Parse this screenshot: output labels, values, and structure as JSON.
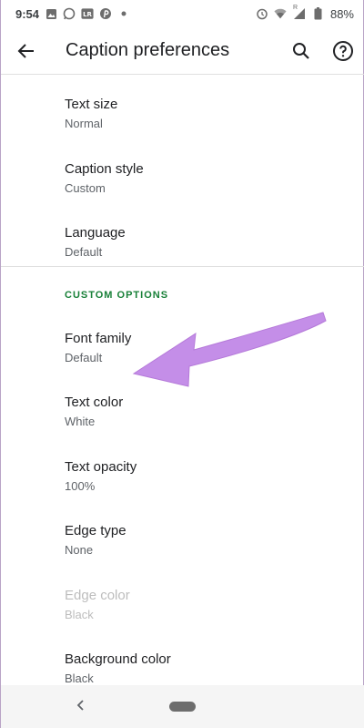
{
  "status_bar": {
    "time": "9:54",
    "battery": "88%",
    "signal_label": "R"
  },
  "app_bar": {
    "title": "Caption preferences"
  },
  "list": {
    "items_top": [
      {
        "title": "Text size",
        "summary": "Normal"
      },
      {
        "title": "Caption style",
        "summary": "Custom"
      },
      {
        "title": "Language",
        "summary": "Default"
      }
    ],
    "section_header": "CUSTOM OPTIONS",
    "items_custom": [
      {
        "title": "Font family",
        "summary": "Default",
        "disabled": false
      },
      {
        "title": "Text color",
        "summary": "White",
        "disabled": false
      },
      {
        "title": "Text opacity",
        "summary": "100%",
        "disabled": false
      },
      {
        "title": "Edge type",
        "summary": "None",
        "disabled": false
      },
      {
        "title": "Edge color",
        "summary": "Black",
        "disabled": true
      },
      {
        "title": "Background color",
        "summary": "Black",
        "disabled": false
      }
    ]
  },
  "colors": {
    "accent_green": "#188038",
    "annotation_arrow": "#c48ee8"
  },
  "icons": {
    "back": "arrow-left",
    "search": "magnifier",
    "help": "question-circle"
  }
}
